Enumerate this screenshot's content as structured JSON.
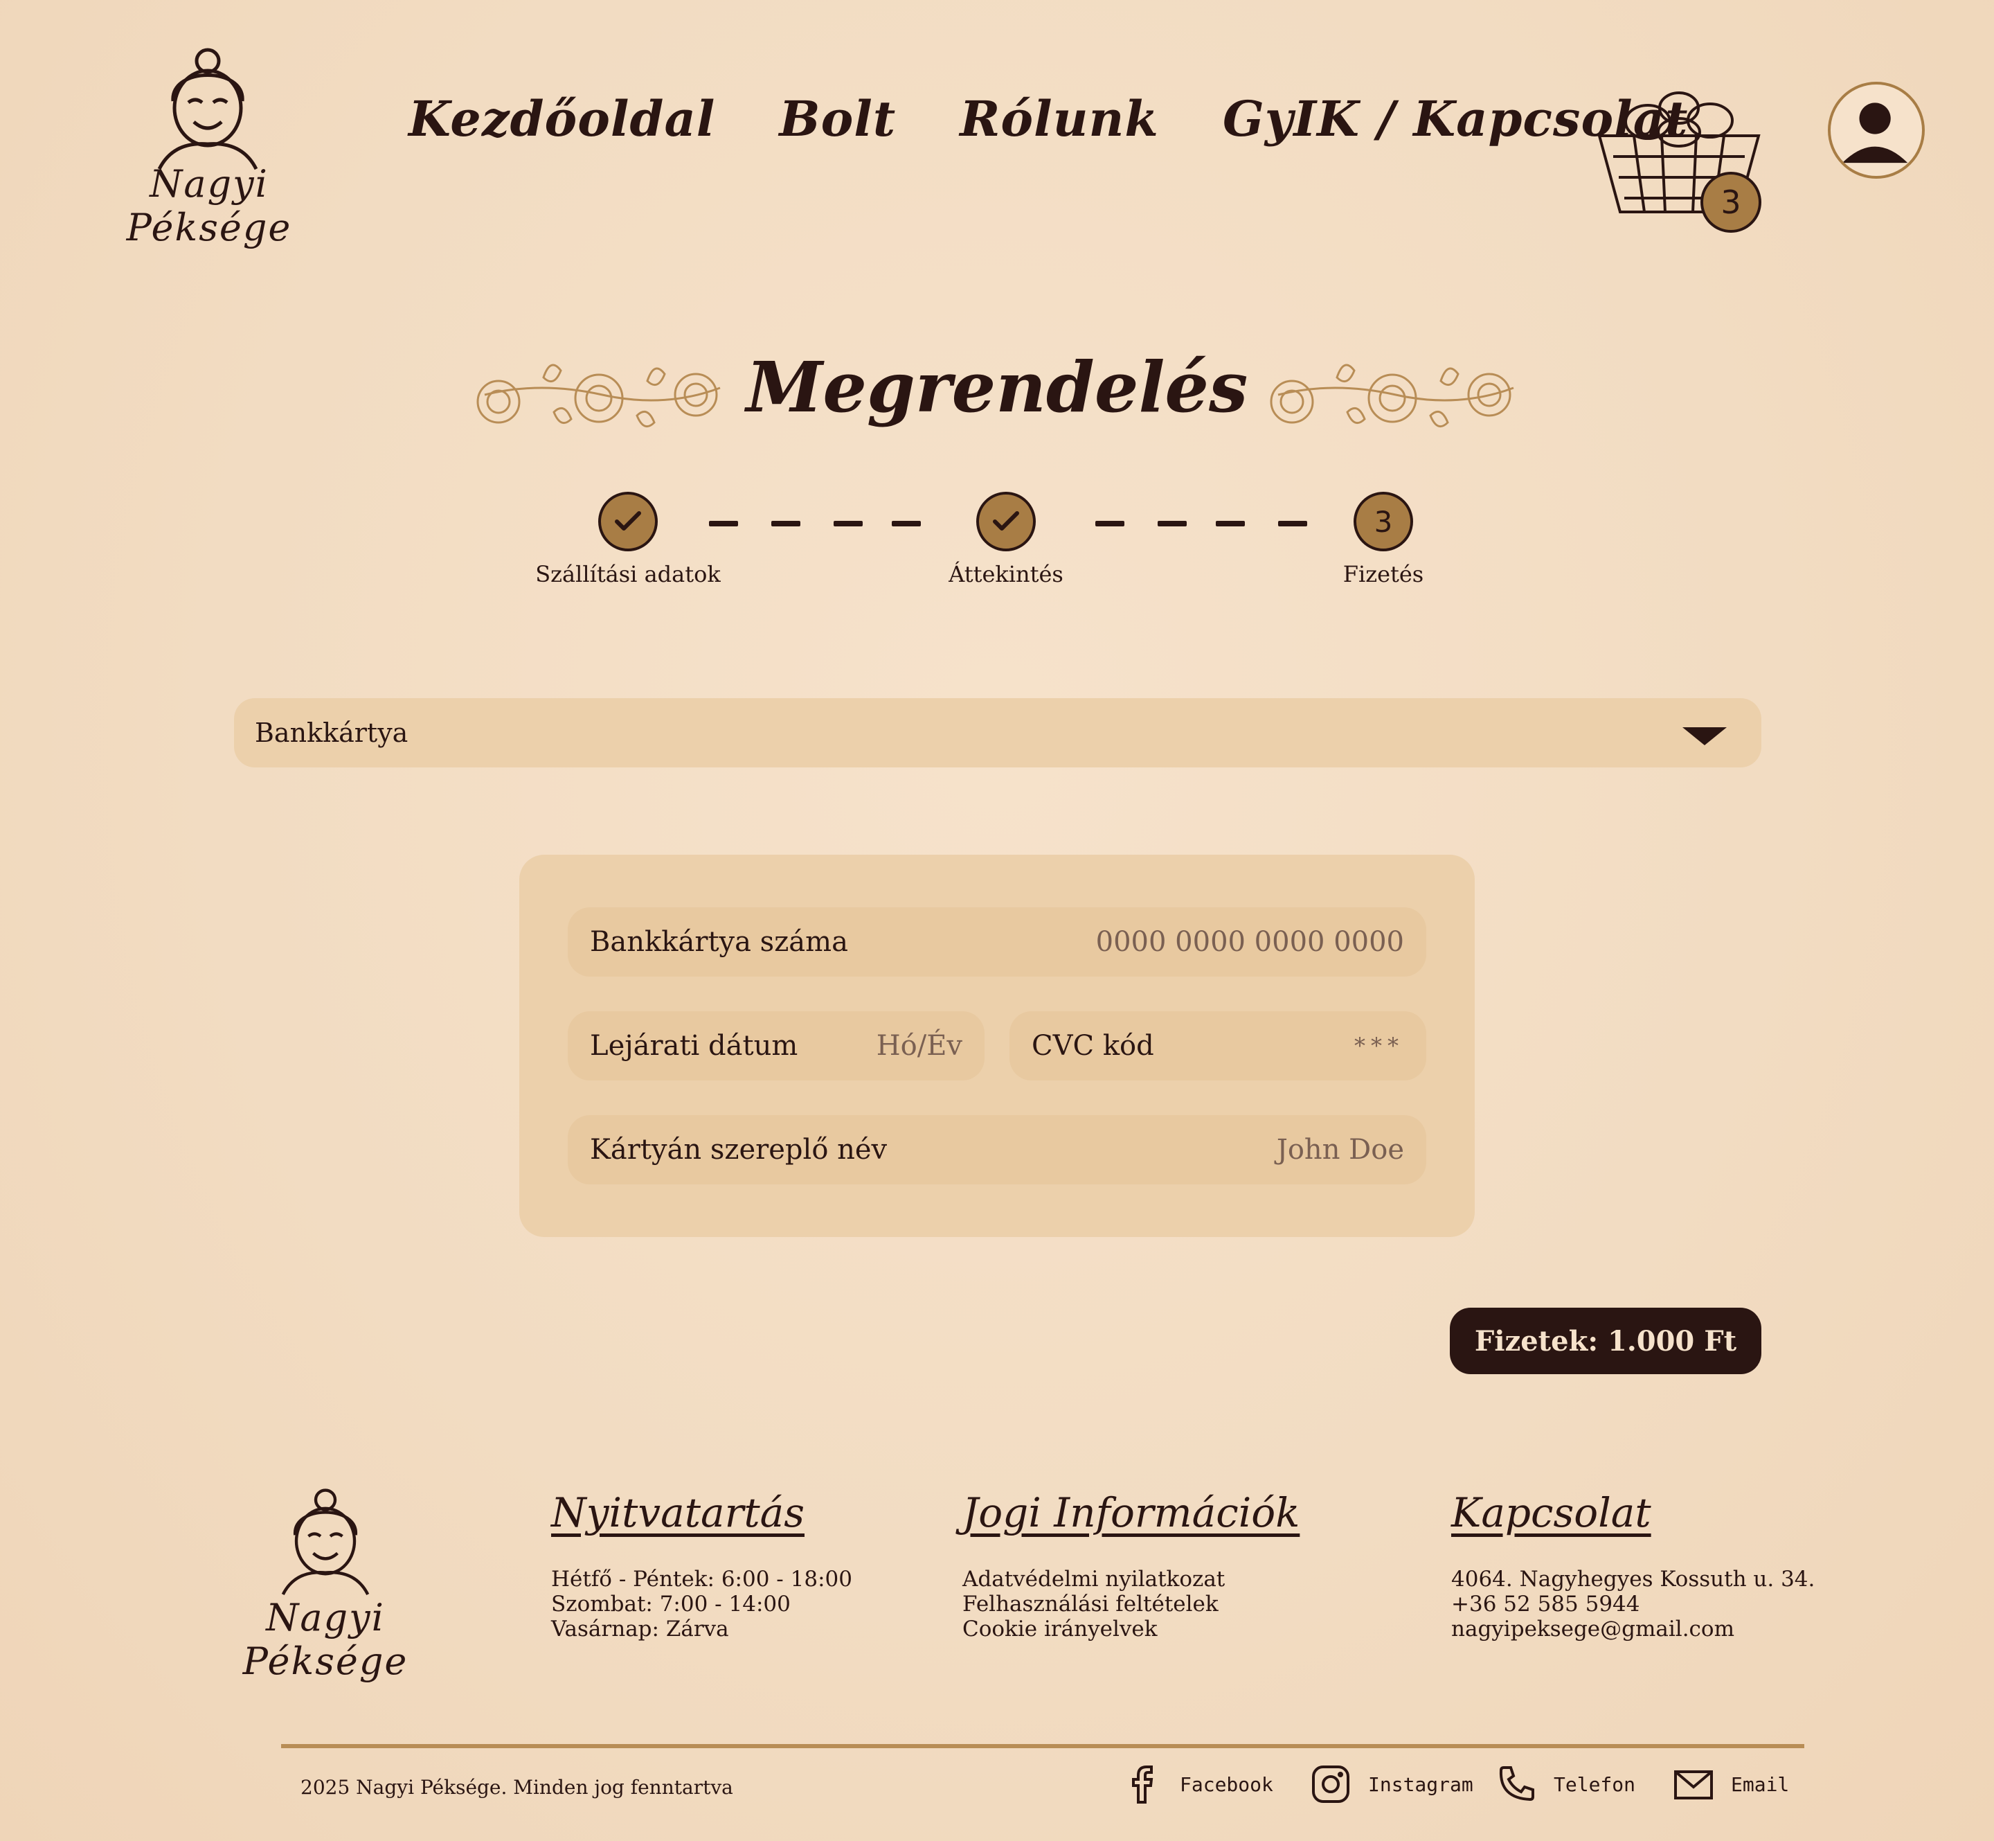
{
  "brand": {
    "name": "Nagyi Péksége"
  },
  "nav": {
    "items": [
      "Kezdőoldal",
      "Bolt",
      "Rólunk",
      "GyIK / Kapcsolat"
    ]
  },
  "cart": {
    "count": "3"
  },
  "page": {
    "title": "Megrendelés"
  },
  "stepper": {
    "steps": [
      {
        "label": "Szállítási adatok",
        "state": "done",
        "icon": "check-icon"
      },
      {
        "label": "Áttekintés",
        "state": "done",
        "icon": "check-icon"
      },
      {
        "label": "Fizetés",
        "state": "current",
        "number": "3"
      }
    ]
  },
  "payment": {
    "method": "Bankkártya",
    "card_number": {
      "label": "Bankkártya száma",
      "placeholder": "0000 0000 0000 0000"
    },
    "expiry": {
      "label": "Lejárati dátum",
      "placeholder": "Hó/Év"
    },
    "cvc": {
      "label": "CVC kód",
      "placeholder": "***"
    },
    "name": {
      "label": "Kártyán szereplő név",
      "placeholder": "John Doe"
    },
    "pay_button": "Fizetek: 1.000 Ft"
  },
  "footer": {
    "hours": {
      "title": "Nyitvatartás",
      "lines": [
        "Hétfő - Péntek: 6:00 - 18:00",
        "Szombat: 7:00 - 14:00",
        "Vasárnap: Zárva"
      ]
    },
    "legal": {
      "title": "Jogi Információk",
      "lines": [
        "Adatvédelmi nyilatkozat",
        "Felhasználási feltételek",
        "Cookie irányelvek"
      ]
    },
    "contact": {
      "title": "Kapcsolat",
      "lines": [
        "4064. Nagyhegyes Kossuth u. 34.",
        "+36 52 585 5944",
        "nagyipeksege@gmail.com"
      ]
    },
    "copyright": "2025 Nagyi Péksége. Minden jog fenntartva",
    "social": [
      {
        "label": "Facebook",
        "icon": "facebook-icon"
      },
      {
        "label": "Instagram",
        "icon": "instagram-icon"
      },
      {
        "label": "Telefon",
        "icon": "phone-icon"
      },
      {
        "label": "Email",
        "icon": "mail-icon"
      }
    ]
  },
  "colors": {
    "background": "#f2dcc2",
    "accent": "#a87d45",
    "dark": "#2a1512",
    "field": "#e8c9a0"
  }
}
